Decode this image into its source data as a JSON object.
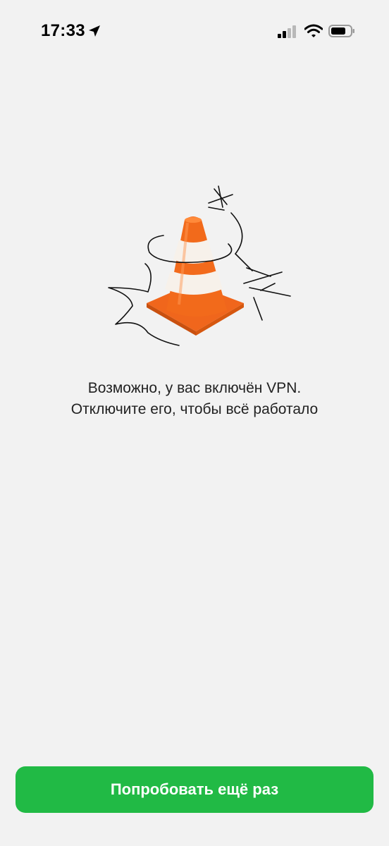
{
  "status_bar": {
    "time": "17:33",
    "icons": [
      "location-arrow-icon",
      "cellular-signal-icon",
      "wifi-icon",
      "battery-icon"
    ]
  },
  "illustration": {
    "icon": "traffic-cone-icon",
    "colors": {
      "cone_orange": "#f26a1b",
      "stripe_white": "#f7f1ea",
      "line": "#111111"
    }
  },
  "message": {
    "line1": "Возможно, у вас включён VPN.",
    "line2": "Отключите его, чтобы всё работало"
  },
  "retry_button": {
    "label": "Попробовать ещё раз",
    "color": "#21ba45"
  }
}
